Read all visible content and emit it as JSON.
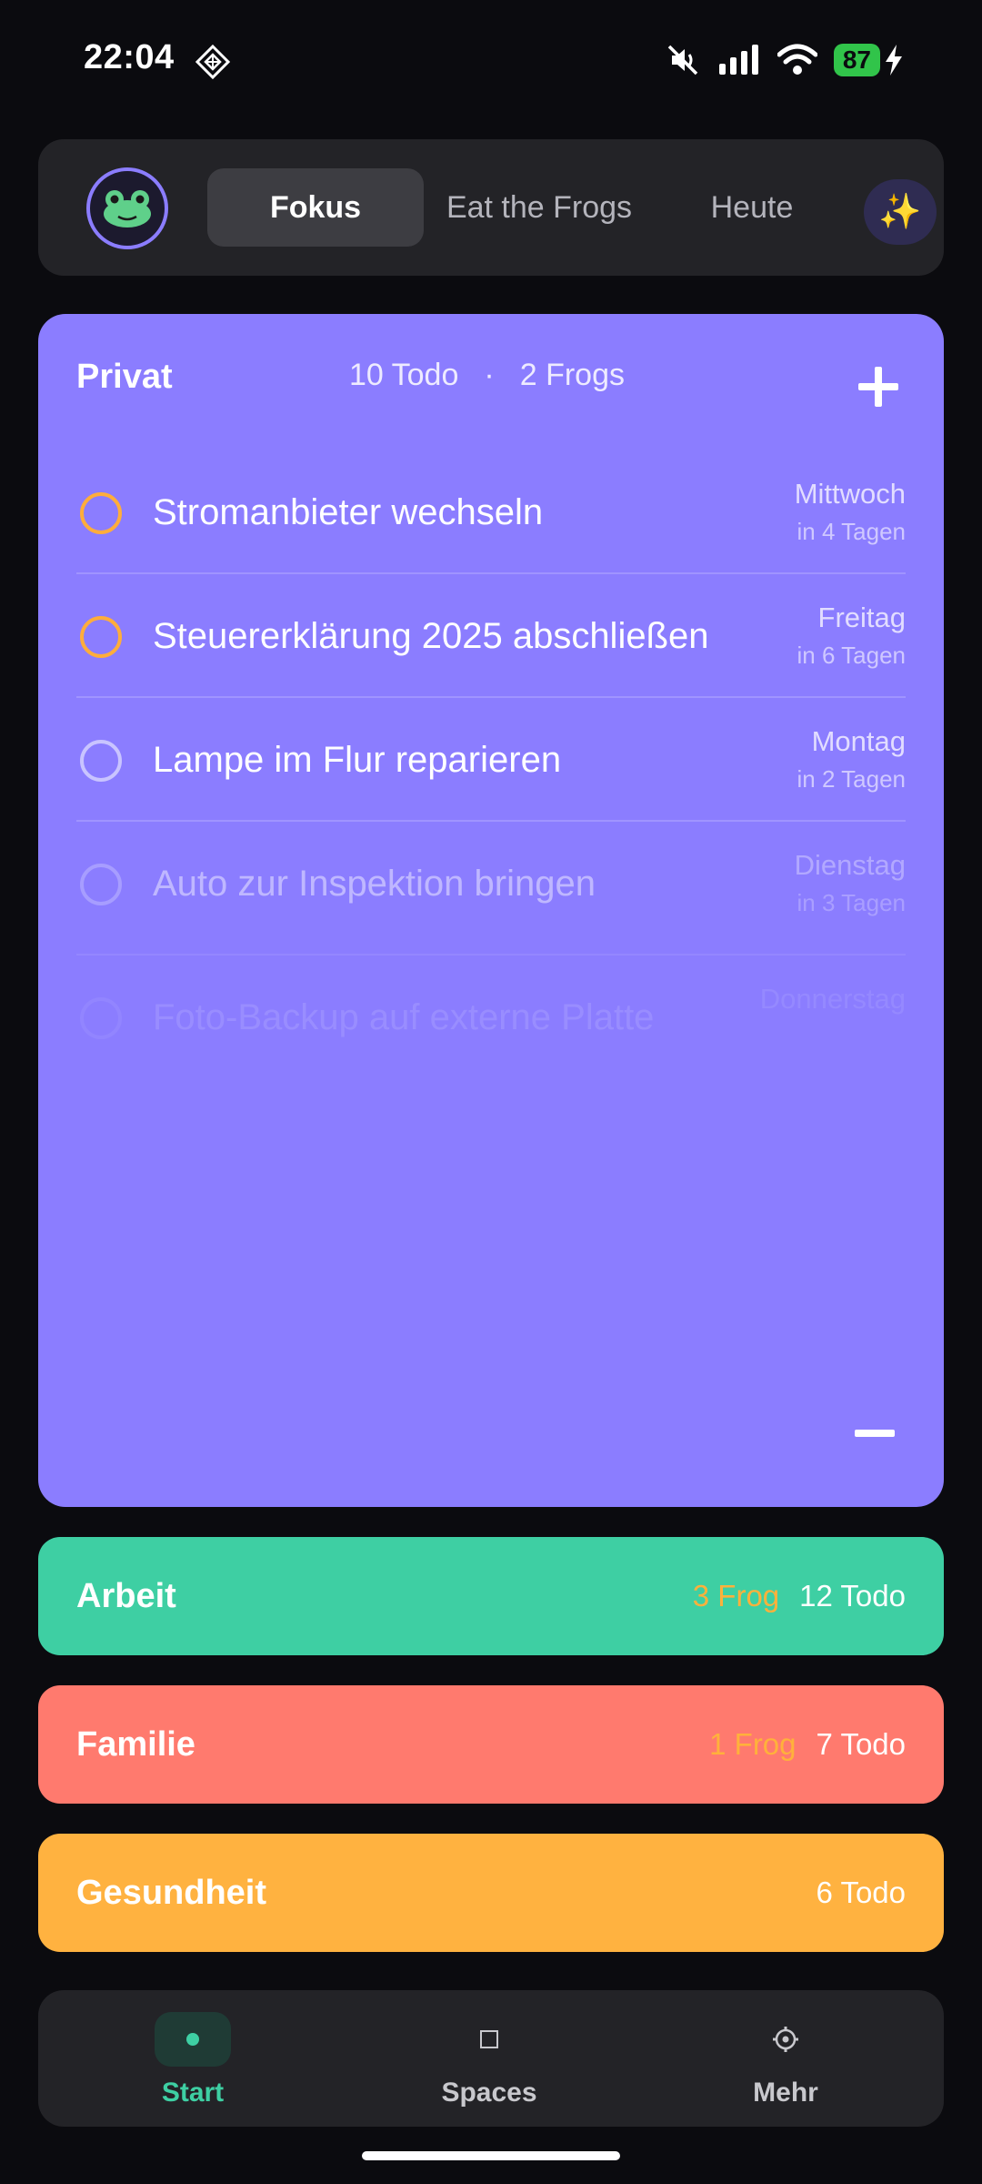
{
  "status_bar": {
    "time": "22:04",
    "app_icon": "diamond-grid-icon",
    "icons": [
      "mute-icon",
      "signal-icon",
      "wifi-icon"
    ],
    "battery": "87",
    "charging_icon": "bolt-icon"
  },
  "top_nav": {
    "avatar_icon": "frog-icon",
    "tabs": [
      {
        "label": "Fokus",
        "active": true
      },
      {
        "label": "Eat the Frogs",
        "active": false
      },
      {
        "label": "Heute",
        "active": false
      }
    ],
    "ai_button_icon": "✨"
  },
  "privat": {
    "title": "Privat",
    "todo_count": "10 Todo",
    "separator": "·",
    "frog_count": "2 Frogs",
    "add_icon": "plus-icon",
    "collapse_icon": "minus-icon",
    "todos": [
      {
        "text": "Stromanbieter wechseln",
        "day": "Mittwoch",
        "relative": "in 4 Tagen",
        "frog": true
      },
      {
        "text": "Steuererklärung 2025 abschließen",
        "day": "Freitag",
        "relative": "in 6 Tagen",
        "frog": true
      },
      {
        "text": "Lampe im Flur reparieren",
        "day": "Montag",
        "relative": "in 2 Tagen",
        "frog": false
      },
      {
        "text": "Auto zur Inspektion bringen",
        "day": "Dienstag",
        "relative": "in 3 Tagen",
        "frog": false
      },
      {
        "text": "Foto-Backup auf externe Platte",
        "day": "Donnerstag",
        "relative": "",
        "frog": false
      }
    ]
  },
  "spaces": [
    {
      "name": "Arbeit",
      "frogs": "3 Frog",
      "todos": "12 Todo",
      "color": "#3ecfa3"
    },
    {
      "name": "Familie",
      "frogs": "1 Frog",
      "todos": "7 Todo",
      "color": "#ff7a6e"
    },
    {
      "name": "Gesundheit",
      "frogs": "",
      "todos": "6 Todo",
      "color": "#ffb240"
    }
  ],
  "bottom_nav": {
    "items": [
      {
        "label": "Start",
        "icon": "dot-icon",
        "active": true
      },
      {
        "label": "Spaces",
        "icon": "square-icon",
        "active": false
      },
      {
        "label": "Mehr",
        "icon": "gear-icon",
        "active": false
      }
    ]
  },
  "colors": {
    "background": "#0b0b0f",
    "privat": "#8b7dff",
    "accent_green": "#3ecfa3",
    "frog_orange": "#ffad3b"
  }
}
